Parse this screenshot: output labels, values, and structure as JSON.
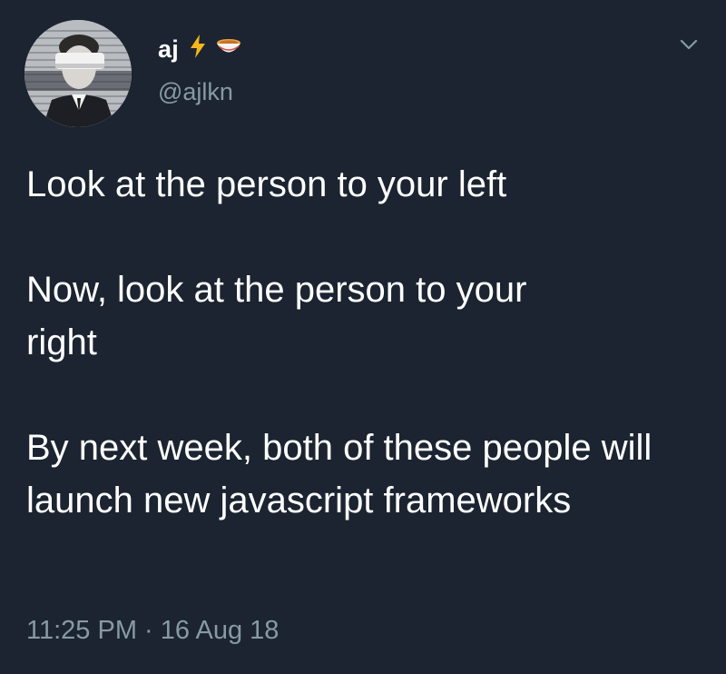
{
  "tweet": {
    "display_name": "aj",
    "name_emojis": [
      "lightning-emoji",
      "ramen-bowl-emoji"
    ],
    "handle": "@ajlkn",
    "paragraphs": [
      "Look at the person to your left",
      "Now, look at the person to your right",
      "By next week, both of these people will launch new javascript frameworks"
    ],
    "time": "11:25 PM",
    "separator": "·",
    "date": "16 Aug 18"
  },
  "icons": {
    "menu": "chevron-down-icon"
  },
  "colors": {
    "background": "#1b2430",
    "primary_text": "#ffffff",
    "secondary_text": "#8899a6",
    "lightning": "#f5b51b"
  }
}
